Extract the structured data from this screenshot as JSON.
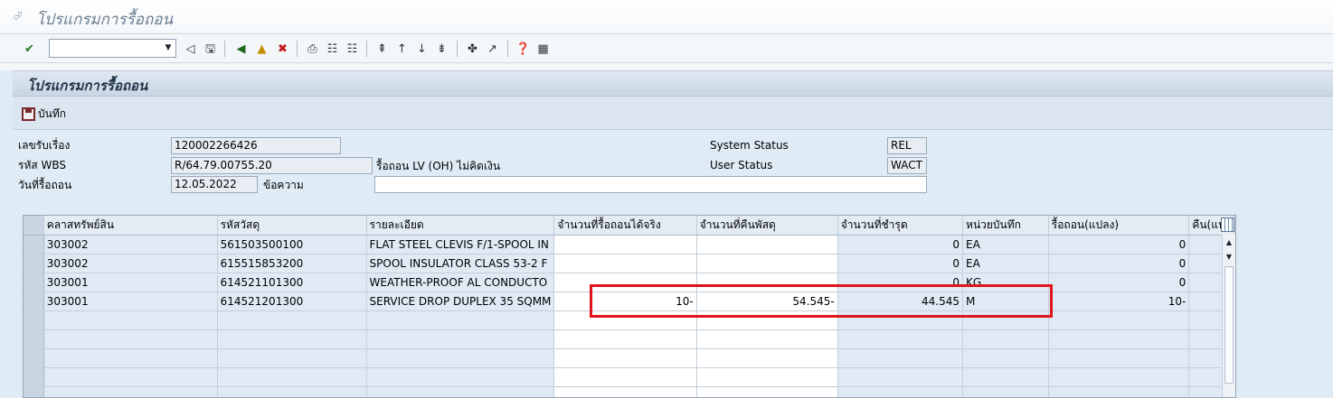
{
  "window": {
    "title": "โปรแกรมการรื้อถอน"
  },
  "toolbar": {
    "command_value": "",
    "icons": [
      "enter-icon",
      "back-arrow-icon",
      "save-icon",
      "back-icon",
      "exit-icon",
      "cancel-icon",
      "print-icon",
      "find-icon",
      "find-next-icon",
      "first-page-icon",
      "previous-page-icon",
      "next-page-icon",
      "last-page-icon",
      "create-session-icon",
      "shortcut-icon",
      "help-icon",
      "layout-icon"
    ]
  },
  "panel": {
    "title": "โปรแกรมการรื้อถอน"
  },
  "appbar": {
    "save_label": "บันทึก"
  },
  "header": {
    "doc_no_label": "เลขรับเรื่อง",
    "doc_no_value": "120002266426",
    "wbs_label": "รหัส WBS",
    "wbs_value": "R/64.79.00755.20",
    "wbs_desc": "รื้อถอน LV (OH) ไม่คิดเงิน",
    "date_label": "วันที่รื้อถอน",
    "date_value": "12.05.2022",
    "message_label": "ข้อความ",
    "message_value": "",
    "system_status_label": "System Status",
    "system_status_value": "REL",
    "user_status_label": "User Status",
    "user_status_value": "WACT"
  },
  "grid": {
    "columns": [
      "คลาสทรัพย์สิน",
      "รหัสวัสดุ",
      "รายละเอียด",
      "จำนวนที่รื้อถอนได้จริง",
      "จำนวนที่คืนพัสดุ",
      "จำนวนที่ชำรุด",
      "หน่วยบันทึก",
      "รื้อถอน(แปลง)",
      "คืน(แปล"
    ],
    "rows": [
      [
        "303002",
        "561503500100",
        "FLAT STEEL CLEVIS F/1-SPOOL IN",
        "",
        "",
        "0",
        "EA",
        "0",
        ""
      ],
      [
        "303002",
        "615515853200",
        "SPOOL INSULATOR CLASS 53-2 F",
        "",
        "",
        "0",
        "EA",
        "0",
        ""
      ],
      [
        "303001",
        "614521101300",
        "WEATHER-PROOF AL CONDUCTO",
        "",
        "",
        "0",
        "KG",
        "0",
        ""
      ],
      [
        "303001",
        "614521201300",
        "SERVICE DROP DUPLEX 35 SQMM",
        "10-",
        "54.545-",
        "44.545",
        "M",
        "10-",
        ""
      ],
      [
        "",
        "",
        "",
        "",
        "",
        "",
        "",
        "",
        ""
      ],
      [
        "",
        "",
        "",
        "",
        "",
        "",
        "",
        "",
        ""
      ],
      [
        "",
        "",
        "",
        "",
        "",
        "",
        "",
        "",
        ""
      ],
      [
        "",
        "",
        "",
        "",
        "",
        "",
        "",
        "",
        ""
      ],
      [
        "",
        "",
        "",
        "",
        "",
        "",
        "",
        "",
        ""
      ]
    ]
  },
  "colors": {
    "highlight": "#e0151b",
    "background": "#dfebf5"
  }
}
